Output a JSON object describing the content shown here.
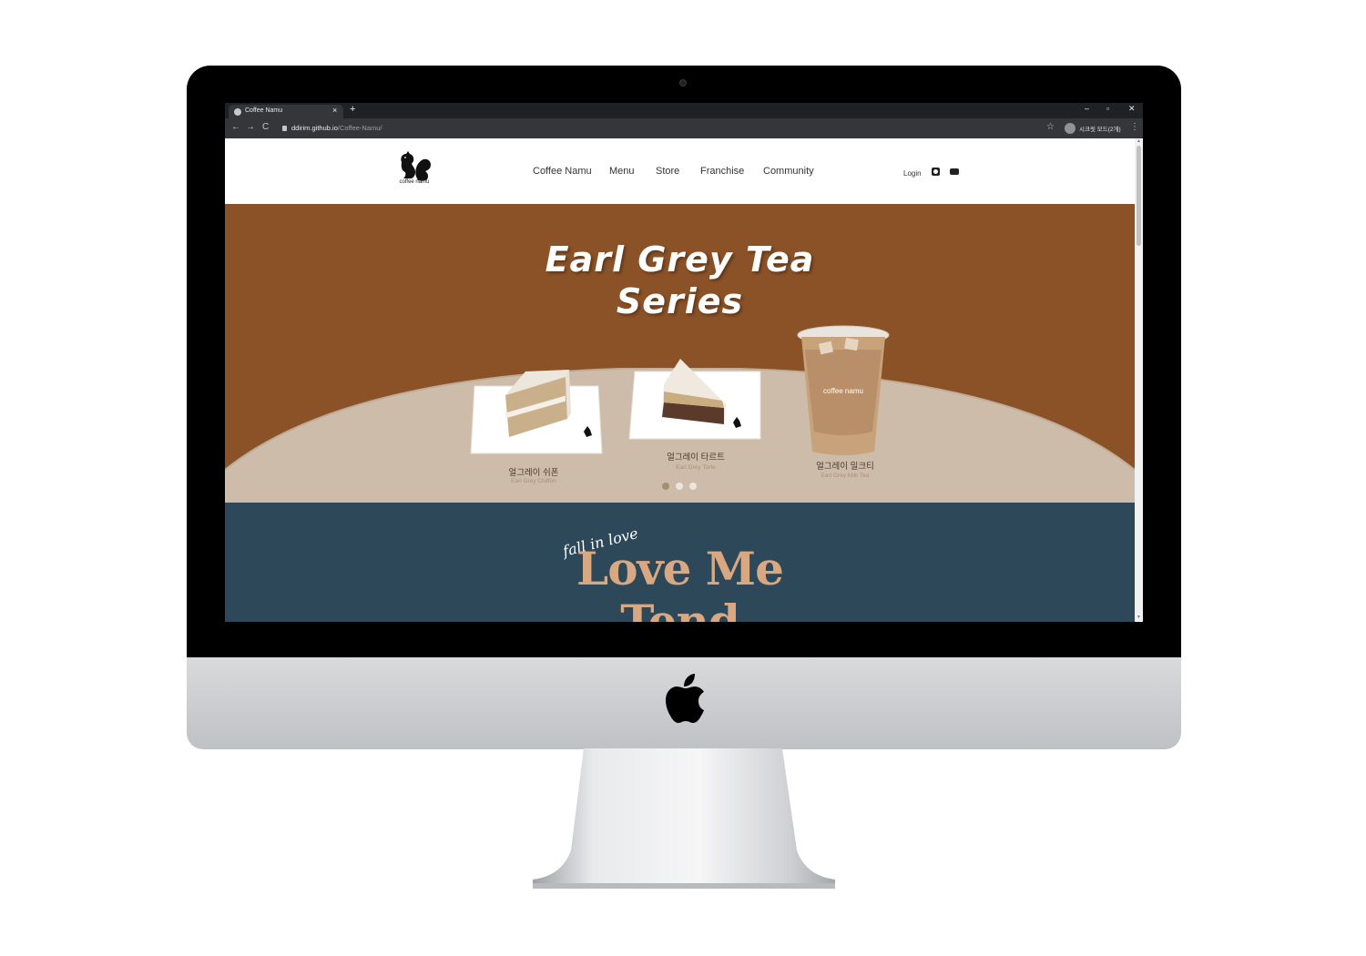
{
  "browser": {
    "tab_title": "Coffee Namu",
    "tab_close": "×",
    "new_tab": "+",
    "minimize": "–",
    "restore": "▫",
    "close": "✕",
    "back": "←",
    "forward": "→",
    "reload": "C",
    "url_host": "ddirim.github.io",
    "url_path": "/Coffee-Namu/",
    "profile_label": "시크릿 모드(2개)",
    "star": "☆",
    "menu": "⋮"
  },
  "site": {
    "logo_text": "coffee namu",
    "nav": [
      "Coffee Namu",
      "Menu",
      "Store",
      "Franchise",
      "Community"
    ],
    "login": "Login",
    "icons": [
      "instagram-icon",
      "blog-icon"
    ]
  },
  "hero": {
    "title_line1": "Earl Grey Tea",
    "title_line2": "Series",
    "products": [
      {
        "name": "얼그레이 쉬폰",
        "sub": "Earl Grey Chiffon"
      },
      {
        "name": "얼그레이 타르트",
        "sub": "Earl Grey Torte"
      },
      {
        "name": "얼그레이 밀크티",
        "sub": "Earl Grey Milk Tea"
      }
    ],
    "cup_label": "coffee namu",
    "active_slide": 1,
    "slide_count": 3
  },
  "love": {
    "script": "fall in love",
    "title": "Love Me",
    "title_cut": "Tend"
  },
  "colors": {
    "hero_bg": "#8b5227",
    "table": "#cdbca9",
    "love_bg": "#2c4859",
    "love_title": "#d8a882"
  }
}
